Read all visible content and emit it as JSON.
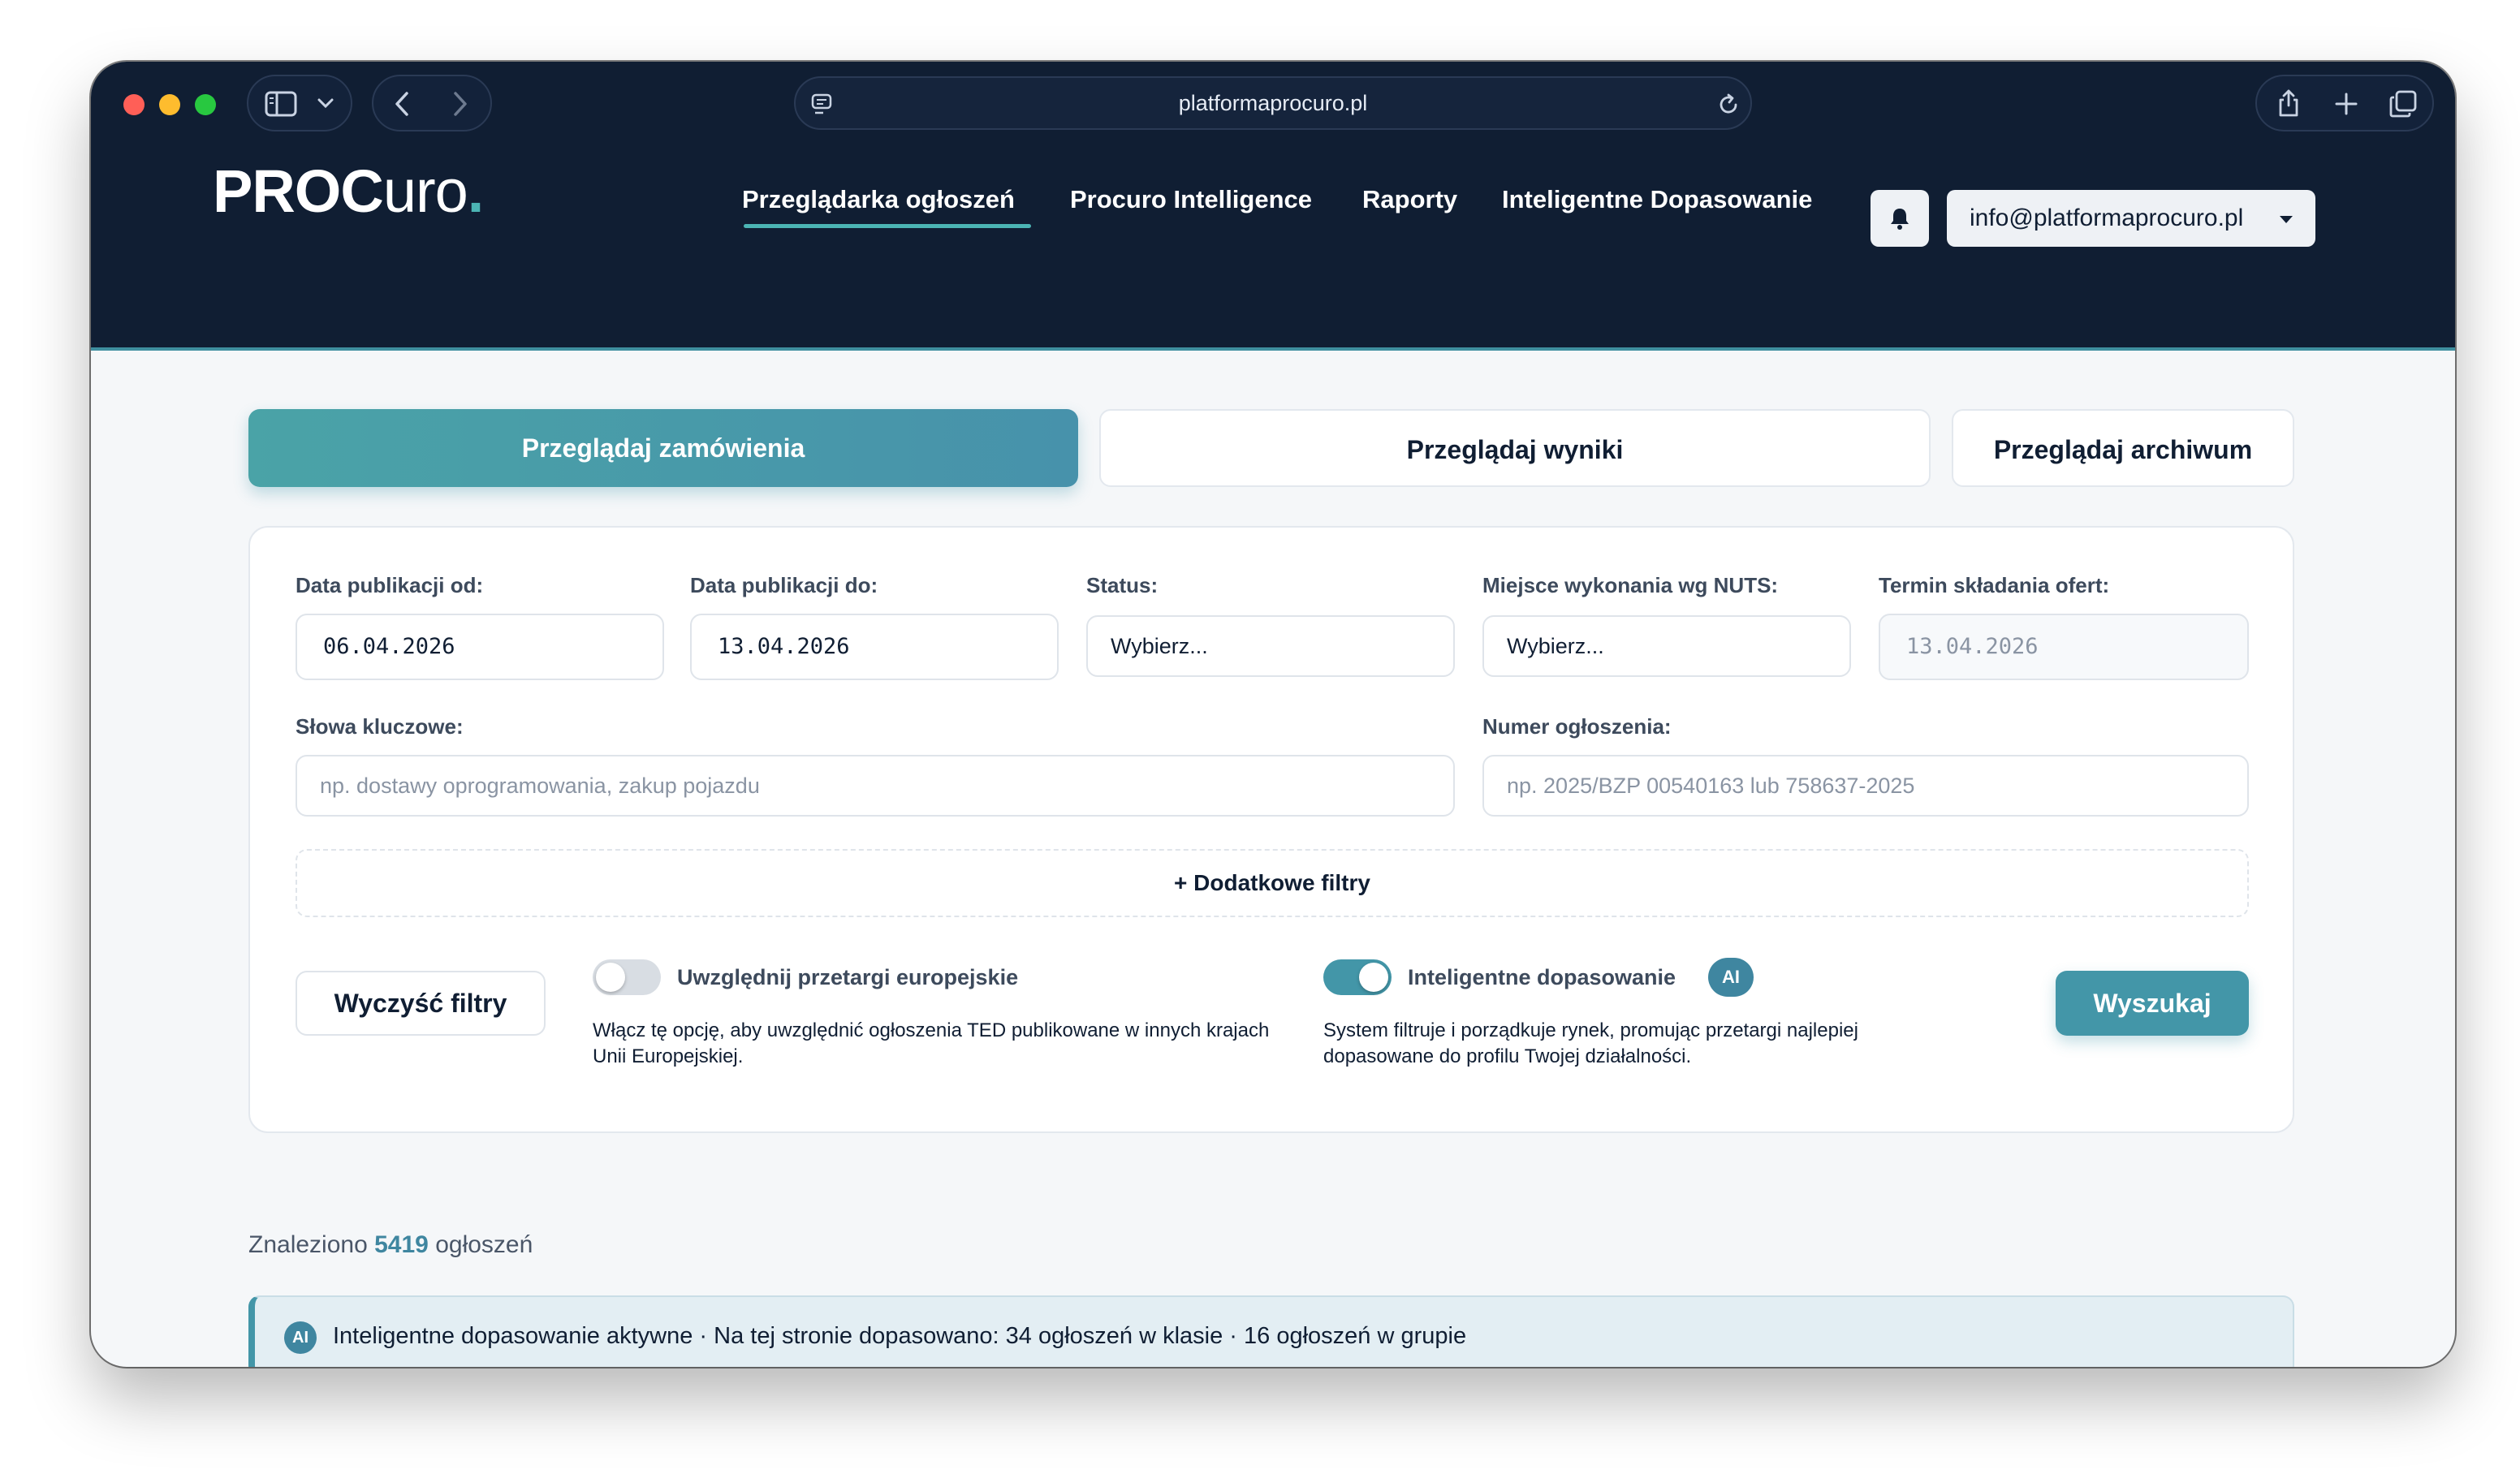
{
  "browser": {
    "url": "platformaprocuro.pl"
  },
  "header": {
    "logo_bold": "PROC",
    "logo_light": "uro",
    "logo_dot": ".",
    "nav": [
      {
        "label": "Przeglądarka ogłoszeń",
        "active": true
      },
      {
        "label": "Procuro Intelligence",
        "active": false
      },
      {
        "label": "Raporty",
        "active": false
      },
      {
        "label": "Inteligentne Dopasowanie",
        "active": false
      }
    ],
    "user_email": "info@platformaprocuro.pl"
  },
  "tabs": [
    {
      "label": "Przeglądaj zamówienia",
      "active": true
    },
    {
      "label": "Przeglądaj wyniki",
      "active": false
    },
    {
      "label": "Przeglądaj archiwum",
      "active": false
    }
  ],
  "filters": {
    "date_from_label": "Data publikacji od:",
    "date_from_value": "06.04.2026",
    "date_to_label": "Data publikacji do:",
    "date_to_value": "13.04.2026",
    "status_label": "Status:",
    "status_value": "Wybierz...",
    "nuts_label": "Miejsce wykonania wg NUTS:",
    "nuts_value": "Wybierz...",
    "deadline_label": "Termin składania ofert:",
    "deadline_placeholder": "13.04.2026",
    "keywords_label": "Słowa kluczowe:",
    "keywords_placeholder": "np. dostawy oprogramowania, zakup pojazdu",
    "number_label": "Numer ogłoszenia:",
    "number_placeholder": "np. 2025/BZP 00540163 lub 758637-2025",
    "more_filters": "+ Dodatkowe filtry",
    "clear_button": "Wyczyść filtry",
    "eu_toggle_title": "Uwzględnij przetargi europejskie",
    "eu_toggle_on": false,
    "eu_toggle_desc": "Włącz tę opcję, aby uwzględnić ogłoszenia TED publikowane w innych krajach Unii Europejskiej.",
    "smart_toggle_title": "Inteligentne dopasowanie",
    "smart_toggle_on": true,
    "smart_badge": "AI",
    "smart_toggle_desc": "System filtruje i porządkuje rynek, promując przetargi najlepiej dopasowane do profilu Twojej działalności.",
    "search_button": "Wyszukaj"
  },
  "results": {
    "found_prefix": "Znaleziono",
    "found_count": "5419",
    "found_suffix": "ogłoszeń",
    "info_badge": "AI",
    "info_text": "Inteligentne dopasowanie aktywne · Na tej stronie dopasowano: 34 ogłoszeń w klasie · 16 ogłoszeń w grupie"
  },
  "colors": {
    "header_bg": "#101e33",
    "accent": "#4396a8",
    "accent_teal": "#4bb4b4",
    "toggle_on": "#4396a8",
    "toggle_off": "#d8dde3",
    "traffic_red": "#ff5f57",
    "traffic_yellow": "#febc2e",
    "traffic_green": "#28c840"
  }
}
